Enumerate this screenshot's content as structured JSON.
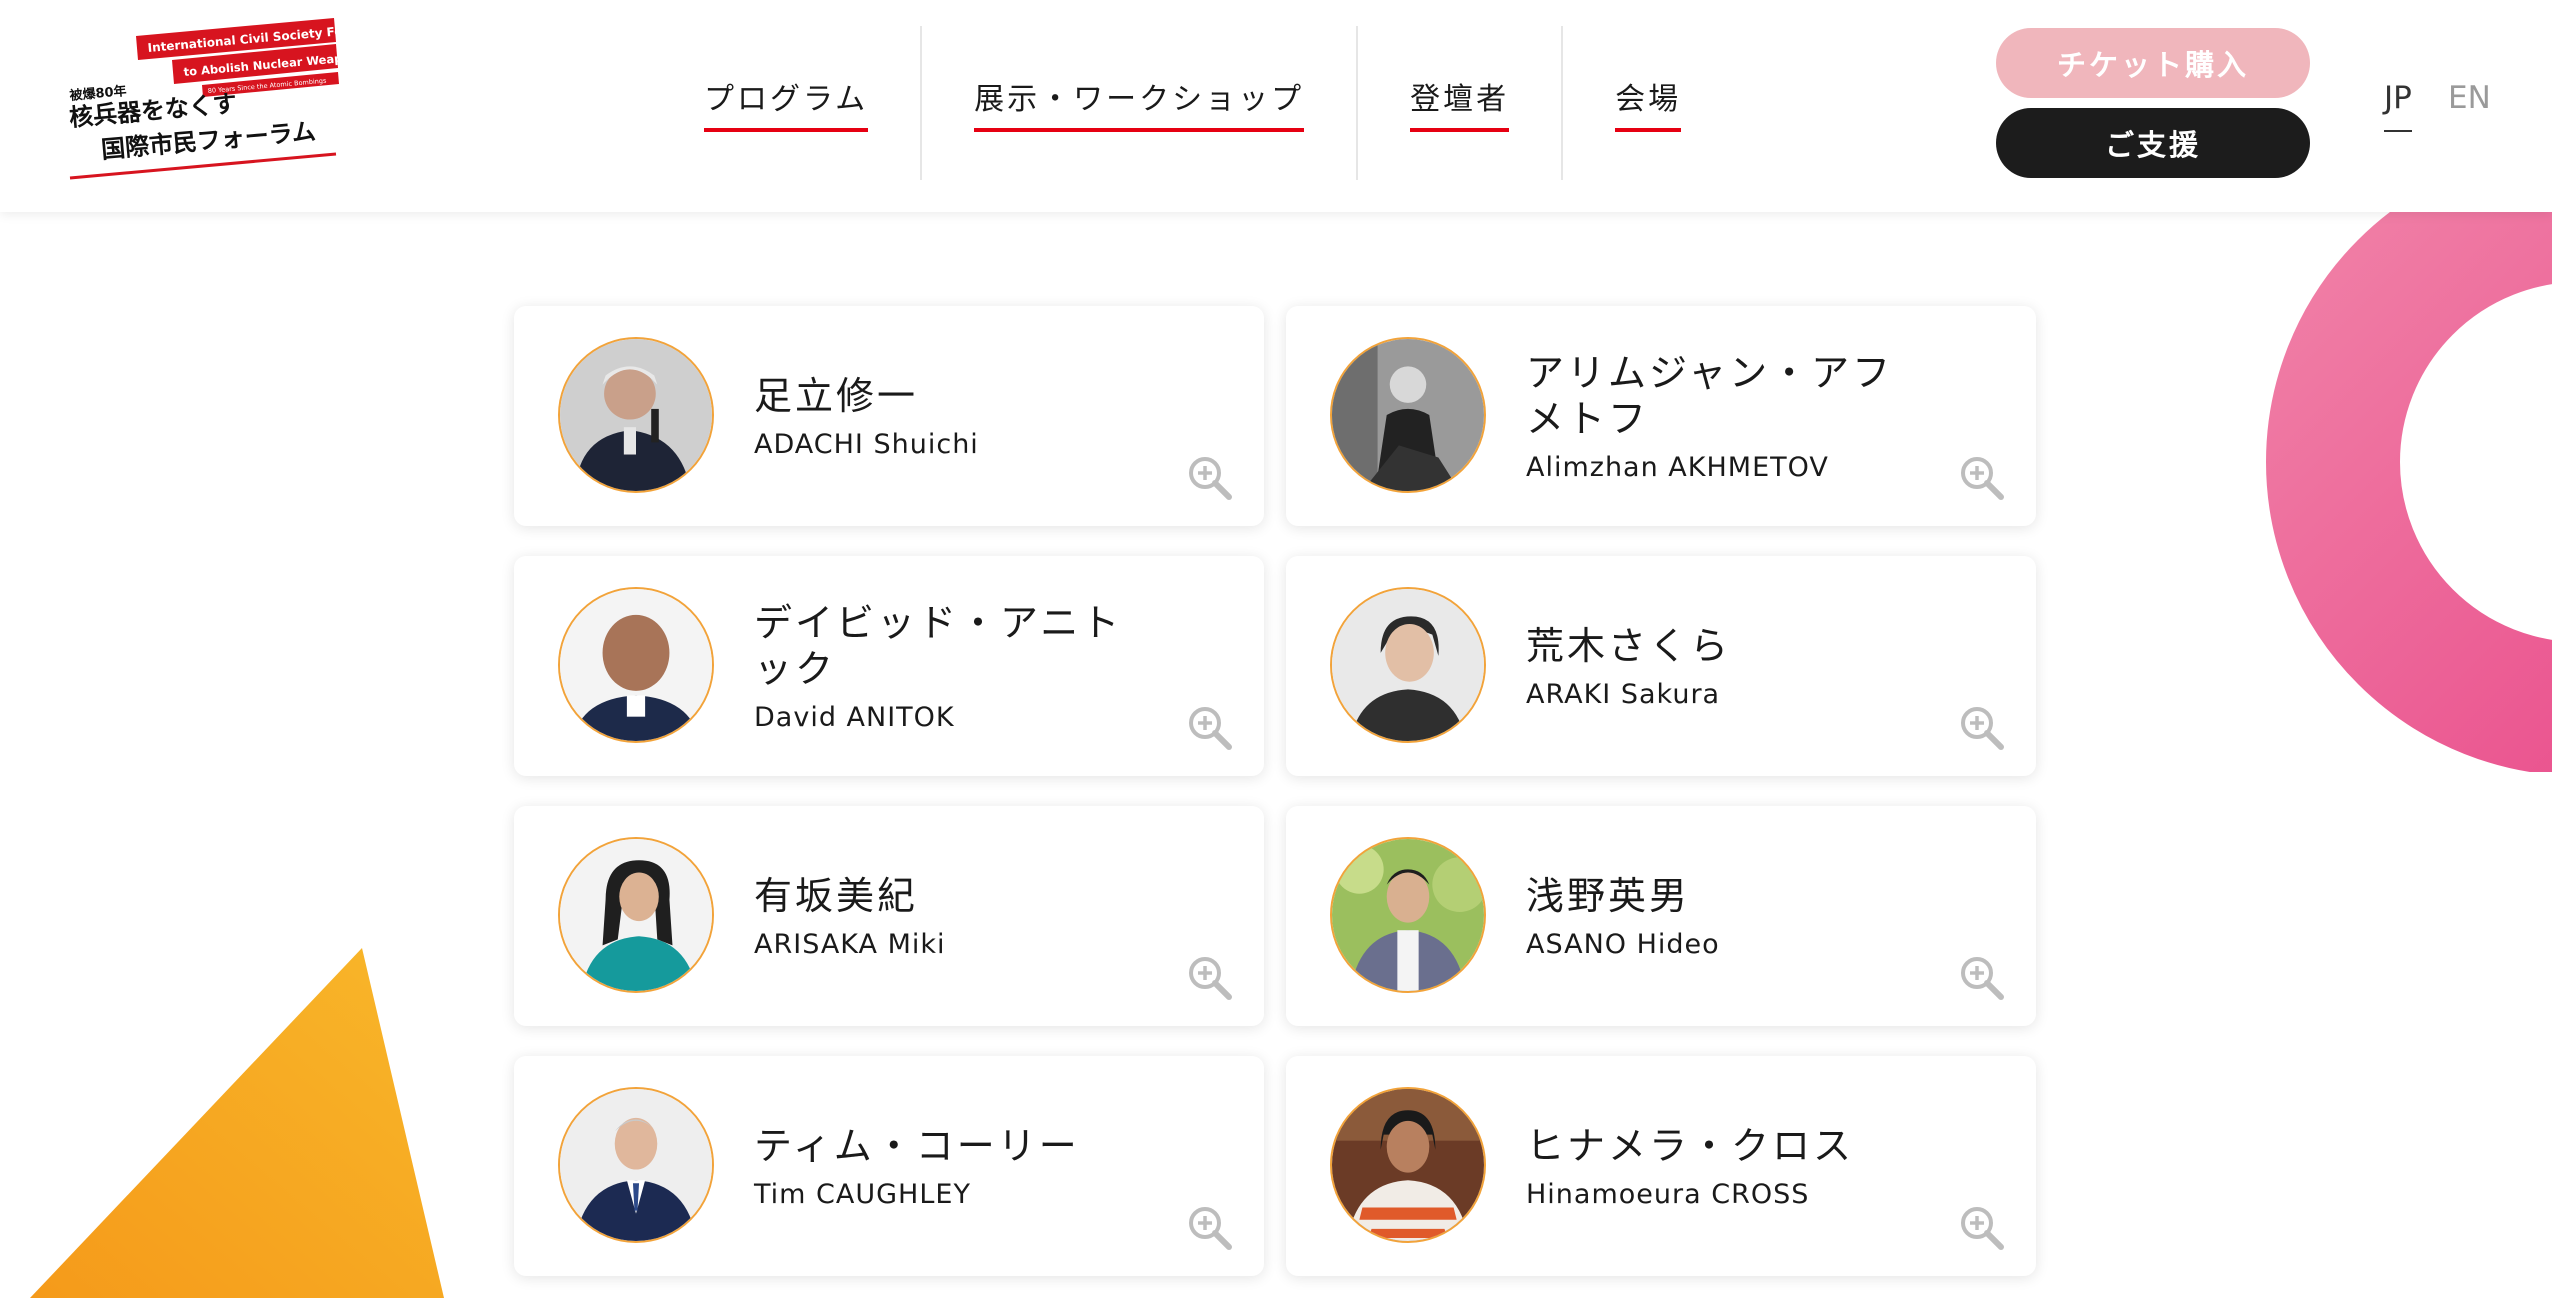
{
  "logo": {
    "line1": "International Civil Society Forum",
    "line2": "to Abolish Nuclear Weapons",
    "line3": "80 Years Since the Atomic Bombings",
    "small": "被爆80年",
    "title1": "核兵器をなくす",
    "title2": "国際市民フォーラム"
  },
  "nav": {
    "items": [
      {
        "label": "プログラム"
      },
      {
        "label": "展示・ワークショップ"
      },
      {
        "label": "登壇者"
      },
      {
        "label": "会場"
      }
    ]
  },
  "actions": {
    "ticket_label": "チケット購入",
    "support_label": "ご支援"
  },
  "lang": {
    "jp": "JP",
    "en": "EN",
    "active": "JP"
  },
  "colors": {
    "accent_red": "#e60012",
    "ticket_pink": "#f0b6bc",
    "avatar_ring": "#f2a33a",
    "ring_pink": "#ee5f9a",
    "triangle_orange": "#f7a91c"
  },
  "speakers": [
    {
      "name_ja": "足立修一",
      "name_en": "ADACHI Shuichi"
    },
    {
      "name_ja": "アリムジャン・アフメトフ",
      "name_en": "Alimzhan AKHMETOV"
    },
    {
      "name_ja": "デイビッド・アニトック",
      "name_en": "David ANITOK"
    },
    {
      "name_ja": "荒木さくら",
      "name_en": "ARAKI Sakura"
    },
    {
      "name_ja": "有坂美紀",
      "name_en": "ARISAKA Miki"
    },
    {
      "name_ja": "浅野英男",
      "name_en": "ASANO Hideo"
    },
    {
      "name_ja": "ティム・コーリー",
      "name_en": "Tim CAUGHLEY"
    },
    {
      "name_ja": "ヒナメラ・クロス",
      "name_en": "Hinamoeura CROSS"
    }
  ],
  "icons": {
    "zoom": "zoom-in-icon"
  }
}
